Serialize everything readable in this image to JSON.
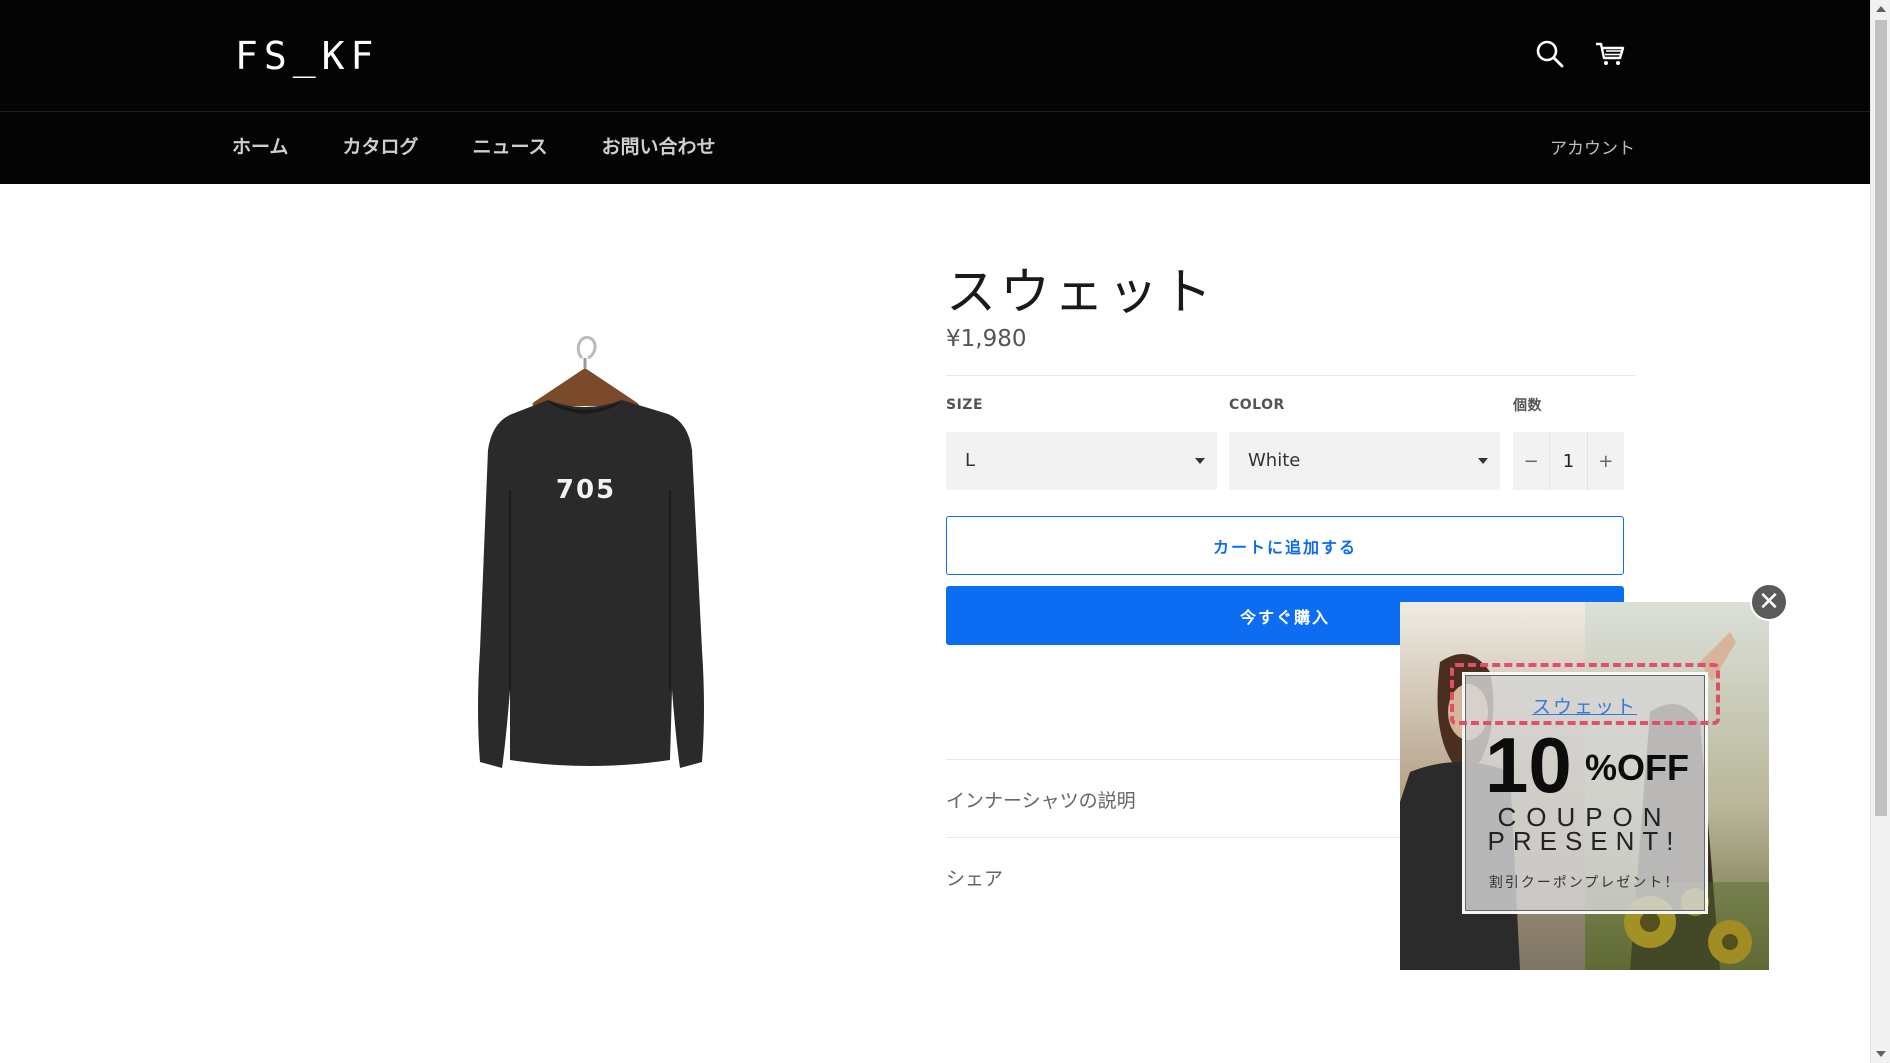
{
  "header": {
    "logo": "FS_KF",
    "nav": [
      "ホーム",
      "カタログ",
      "ニュース",
      "お問い合わせ"
    ],
    "account": "アカウント",
    "icons": [
      "search-icon",
      "cart-icon"
    ]
  },
  "product": {
    "title": "スウェット",
    "price": "¥1,980",
    "shirt_print": "705",
    "options": {
      "size_label": "SIZE",
      "size_value": "L",
      "color_label": "COLOR",
      "color_value": "White",
      "qty_label": "個数",
      "qty_minus": "−",
      "qty_value": "1",
      "qty_plus": "+"
    },
    "add_to_cart": "カートに追加する",
    "buy_now": "今すぐ購入",
    "accordion": [
      "インナーシャツの説明",
      "シェア"
    ]
  },
  "popup": {
    "link_text": "スウェット",
    "discount": "10",
    "discount_unit": "%OFF",
    "line1": "COUPON",
    "line2": "PRESENT!",
    "subtitle": "割引クーポンプレゼント！",
    "close_symbol": "✕"
  },
  "colors": {
    "header_bg": "#040404",
    "accent": "#0c6cf2",
    "coupon_dash": "#e0506b"
  }
}
